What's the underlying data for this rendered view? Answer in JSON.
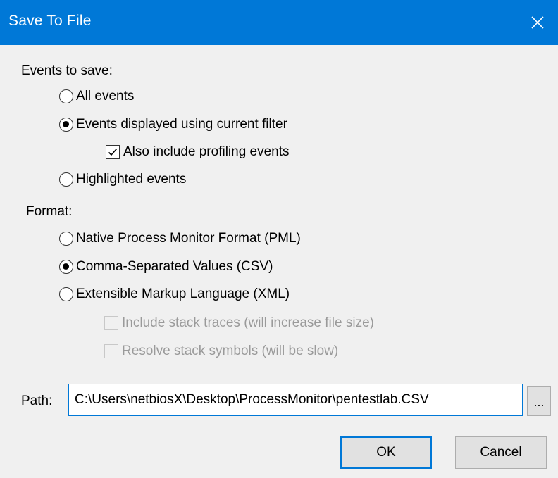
{
  "window": {
    "title": "Save To File",
    "close_icon": "close-icon"
  },
  "events": {
    "label": "Events to save:",
    "all": "All events",
    "filtered": "Events displayed using current filter",
    "profiling": "Also include profiling events",
    "highlighted": "Highlighted events",
    "selected": "filtered",
    "profiling_checked": true
  },
  "format": {
    "label": "Format:",
    "pml": "Native Process Monitor Format (PML)",
    "csv": "Comma-Separated Values (CSV)",
    "xml": "Extensible Markup Language (XML)",
    "stack_traces": "Include stack traces (will increase file size)",
    "stack_symbols": "Resolve stack symbols (will be slow)",
    "selected": "csv"
  },
  "path": {
    "label": "Path:",
    "value": "C:\\Users\\netbiosX\\Desktop\\ProcessMonitor\\pentestlab.CSV",
    "browse_label": "..."
  },
  "buttons": {
    "ok": "OK",
    "cancel": "Cancel"
  },
  "colors": {
    "titlebar": "#0078d7",
    "background": "#f0f0f0",
    "disabled_text": "#9a9a9a"
  }
}
